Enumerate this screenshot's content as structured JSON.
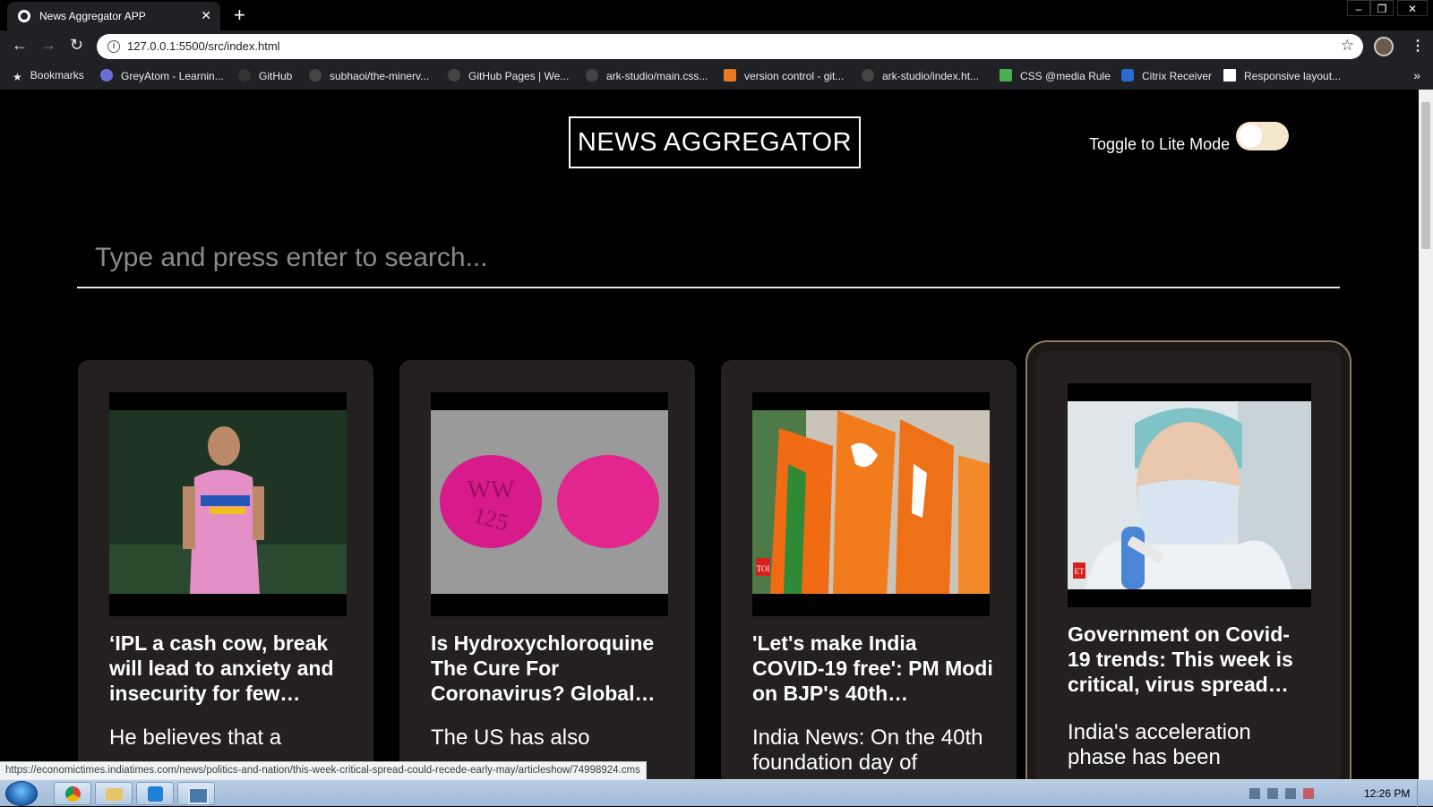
{
  "browser": {
    "tab_title": "News Aggregator APP",
    "url": "127.0.0.1:5500/src/index.html",
    "bookmarks": [
      "Bookmarks",
      "GreyAtom - Learnin...",
      "GitHub",
      "subhaoi/the-minerv...",
      "GitHub Pages | We...",
      "ark-studio/main.css...",
      "version control - git...",
      "ark-studio/index.ht...",
      "CSS @media Rule",
      "Citrix Receiver",
      "Responsive layout..."
    ],
    "status_url": "https://economictimes.indiatimes.com/news/politics-and-nation/this-week-critical-spread-could-recede-early-may/articleshow/74998924.cms"
  },
  "page": {
    "title": "NEWS AGGREGATOR",
    "toggle_label": "Toggle to Lite Mode",
    "search_placeholder": "Type and press enter to search..."
  },
  "cards": [
    {
      "title": "‘IPL a cash cow, break will lead to anxiety and insecurity for few…",
      "desc": "He believes that a",
      "image": "cricket-coach-photo"
    },
    {
      "title": "Is Hydroxychloroquine The Cure For Coronavirus? Global…",
      "desc": "The US has also",
      "image": "pink-pills-photo"
    },
    {
      "title": "'Let's make India COVID-19 free': PM Modi on BJP's 40th…",
      "desc": "India News: On the 40th foundation day of",
      "image": "bjp-flags-photo"
    },
    {
      "title": "Government on Covid-19 trends: This week is critical, virus spread…",
      "desc": "India's acceleration phase has been",
      "image": "lab-worker-mask-photo"
    }
  ],
  "taskbar": {
    "clock": "12:26 PM"
  },
  "colors": {
    "background": "#000000",
    "card": "#242020",
    "toggle": "#f4e7cd"
  }
}
